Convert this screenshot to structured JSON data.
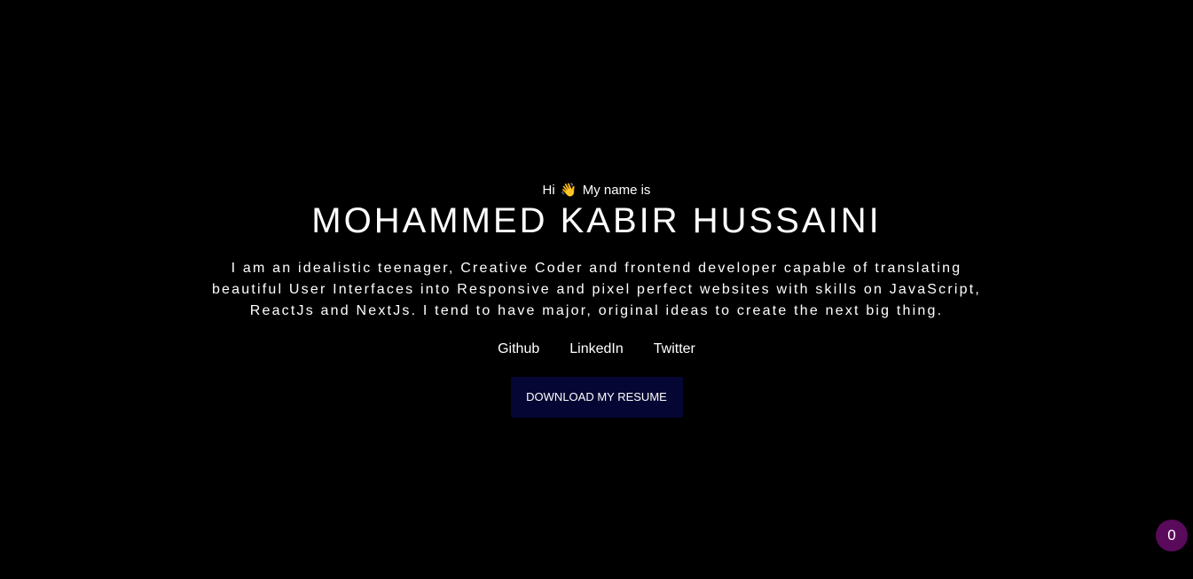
{
  "hero": {
    "greeting_prefix": "Hi",
    "wave_emoji": "👋",
    "greeting_suffix": "My name is",
    "name": "MOHAMMED KABIR HUSSAINI",
    "bio_line_1": "I am an idealistic teenager, Creative Coder and frontend developer capable of translating",
    "bio_line_2": "beautiful User Interfaces into Responsive and pixel perfect websites with skills on JavaScript,",
    "bio_line_3": "ReactJs and NextJs. I tend to have major, original ideas to create the next big thing."
  },
  "socials": [
    {
      "label": "Github"
    },
    {
      "label": "LinkedIn"
    },
    {
      "label": "Twitter"
    }
  ],
  "cta": {
    "label": "DOWNLOAD MY RESUME",
    "color": "#060634"
  },
  "counter_badge": {
    "value": "0",
    "color": "#5a0a5a"
  }
}
